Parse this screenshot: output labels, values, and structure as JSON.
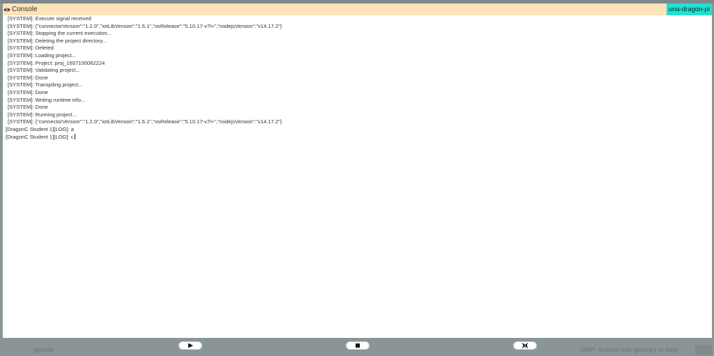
{
  "header": {
    "title": "Console",
    "device": "una-dragon-pi"
  },
  "log": [
    {
      "type": "sys",
      "text": "[SYSTEM]: Execute signal received"
    },
    {
      "type": "sys",
      "text": "[SYSTEM]: {\"connectorVersion\":\"1.2.0\",\"iotLibVersion\":\"1.6.1\",\"osRelease\":\"5.10.17-v7l+\",\"nodejsVersion\":\"v14.17.2\"}"
    },
    {
      "type": "sys",
      "text": "[SYSTEM]: Stopping the current execution..."
    },
    {
      "type": "sys",
      "text": "[SYSTEM]: Deleting the project directory..."
    },
    {
      "type": "sys",
      "text": "[SYSTEM]: Deleted"
    },
    {
      "type": "sys",
      "text": "[SYSTEM]: Loading project..."
    },
    {
      "type": "sys",
      "text": "[SYSTEM]: Project: proj_1657100062224"
    },
    {
      "type": "sys",
      "text": "[SYSTEM]: Validating project..."
    },
    {
      "type": "sys",
      "text": "[SYSTEM]: Done"
    },
    {
      "type": "sys",
      "text": "[SYSTEM]: Transpiling project..."
    },
    {
      "type": "sys",
      "text": "[SYSTEM]: Done"
    },
    {
      "type": "sys",
      "text": "[SYSTEM]: Writing runtime info..."
    },
    {
      "type": "sys",
      "text": "[SYSTEM]: Done"
    },
    {
      "type": "sys",
      "text": "[SYSTEM]: Running project..."
    },
    {
      "type": "sys",
      "text": "[SYSTEM]: {\"connectorVersion\":\"1.2.0\",\"iotLibVersion\":\"1.6.1\",\"osRelease\":\"5.10.17-v7l+\",\"nodejsVersion\":\"v14.17.2\"}"
    },
    {
      "type": "user",
      "text": "[DragonC Student 1][LOG]: a"
    },
    {
      "type": "user",
      "text": "[DragonC Student 1][LOG]: c"
    }
  ],
  "footer": {
    "left_text": "pycode",
    "right_text": "SIRP: Arduino sub-glossary in daily"
  },
  "colors": {
    "header_bg": "#fde3b8",
    "badge_bg": "#23e0cf",
    "overlay": "#8a9598"
  },
  "icons": {
    "title_icon": "eye-icon",
    "run": "play-icon",
    "stop": "stop-icon",
    "shrink": "shrink-icon"
  }
}
